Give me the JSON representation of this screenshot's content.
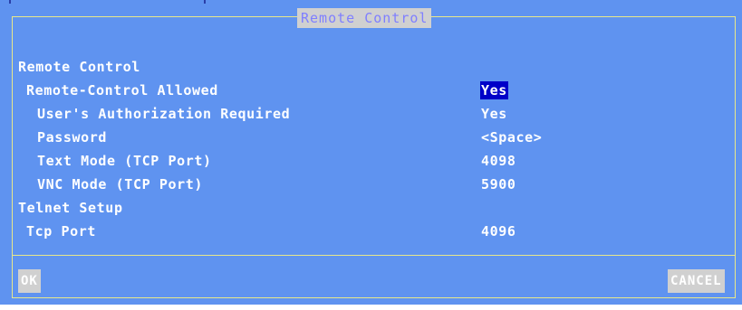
{
  "dialog": {
    "title": "Remote Control"
  },
  "sections": {
    "remote_control": "Remote Control",
    "telnet_setup": "Telnet Setup"
  },
  "fields": {
    "remote_control_allowed": {
      "label": "Remote-Control Allowed",
      "value": "Yes"
    },
    "user_authorization": {
      "label": "User's Authorization Required",
      "value": "Yes"
    },
    "password": {
      "label": "Password",
      "value": "<Space>"
    },
    "text_mode_port": {
      "label": "Text Mode (TCP Port)",
      "value": "4098"
    },
    "vnc_mode_port": {
      "label": "VNC Mode (TCP Port)",
      "value": "5900"
    },
    "tcp_port": {
      "label": "Tcp Port",
      "value": "4096"
    }
  },
  "buttons": {
    "ok": "OK",
    "cancel": "CANCEL"
  },
  "colors": {
    "background": "#5f93f0",
    "frame": "#e8e88a",
    "title_bg": "#d0d0d0",
    "title_text": "#7f7fff",
    "selection": "#0000c8",
    "text": "#ffffff"
  }
}
